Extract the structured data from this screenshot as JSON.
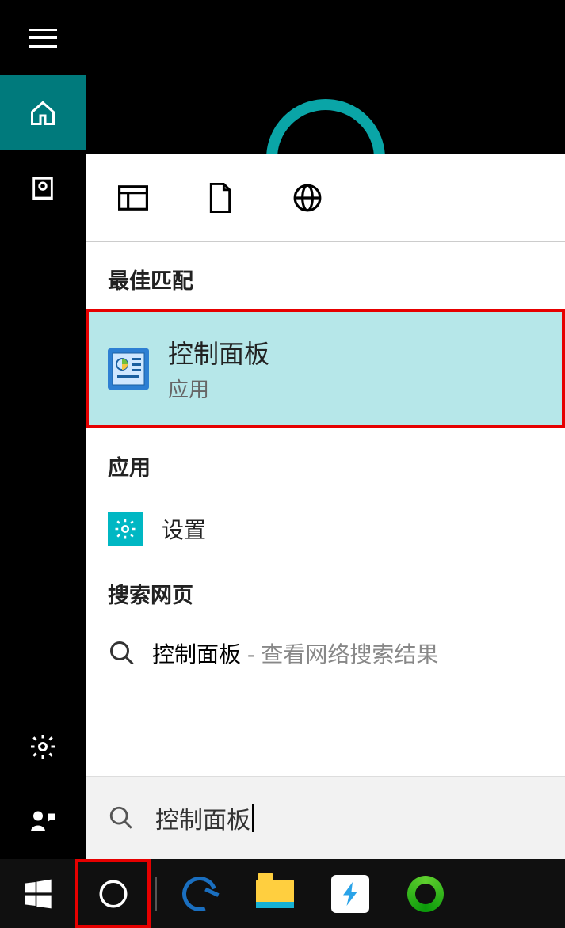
{
  "sections": {
    "best_match": "最佳匹配",
    "apps": "应用",
    "web": "搜索网页"
  },
  "results": {
    "control_panel": {
      "title": "控制面板",
      "subtitle": "应用"
    },
    "settings": {
      "title": "设置"
    },
    "web_item": {
      "query": "控制面板",
      "extra": "查看网络搜索结果"
    }
  },
  "search": {
    "value": "控制面板"
  }
}
